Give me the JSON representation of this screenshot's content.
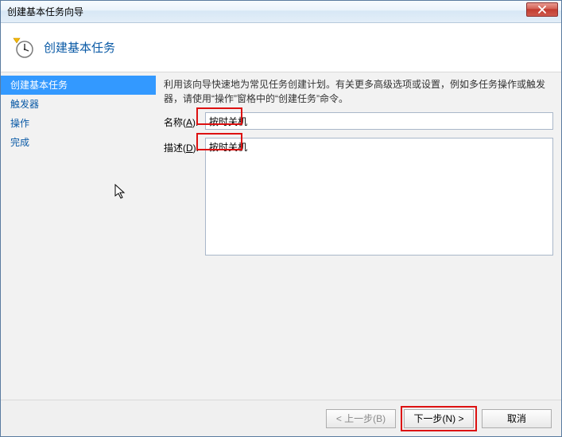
{
  "window": {
    "title": "创建基本任务向导"
  },
  "header": {
    "title": "创建基本任务"
  },
  "sidebar": {
    "items": [
      {
        "label": "创建基本任务",
        "selected": true
      },
      {
        "label": "触发器",
        "selected": false
      },
      {
        "label": "操作",
        "selected": false
      },
      {
        "label": "完成",
        "selected": false
      }
    ]
  },
  "content": {
    "help": "利用该向导快速地为常见任务创建计划。有关更多高级选项或设置，例如多任务操作或触发器，请使用“操作”窗格中的“创建任务”命令。",
    "name_label_pre": "名称(",
    "name_label_key": "A",
    "name_label_post": "):",
    "name_value": "按时关机",
    "desc_label_pre": "描述(",
    "desc_label_key": "D",
    "desc_label_post": "):",
    "desc_value": "按时关机"
  },
  "footer": {
    "back": "< 上一步(B)",
    "next": "下一步(N) >",
    "cancel": "取消"
  },
  "icons": {
    "close": "close-icon",
    "clock": "clock-icon"
  },
  "colors": {
    "accent": "#3399ff",
    "link": "#0a5aa6",
    "highlight": "#d11"
  }
}
